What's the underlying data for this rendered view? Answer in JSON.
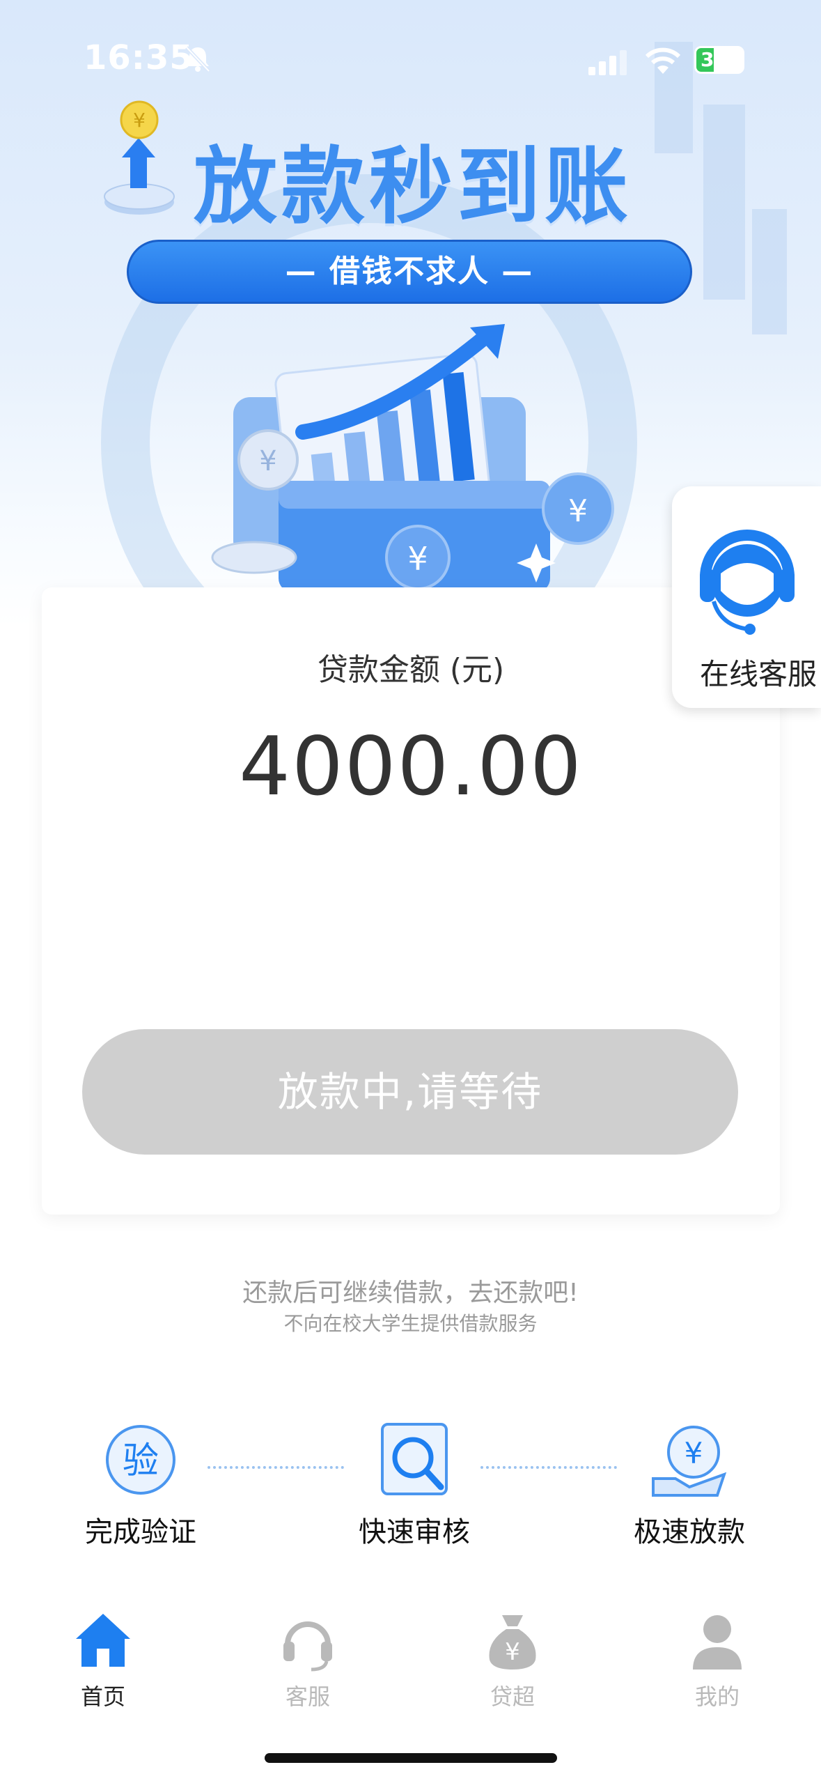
{
  "status_bar": {
    "time": "16:35",
    "battery": "36"
  },
  "banner": {
    "headline": "放款秒到账",
    "slogan": "— 借钱不求人 —"
  },
  "loan_card": {
    "amount_label": "贷款金额 (元)",
    "amount_value": "4000.00",
    "status_button": "放款中,请等待"
  },
  "online_service": {
    "label": "在线客服"
  },
  "notices": {
    "line1": "还款后可继续借款，去还款吧!",
    "line2": "不向在校大学生提供借款服务"
  },
  "steps": [
    {
      "label": "完成验证",
      "icon": "verify-icon",
      "glyph": "验"
    },
    {
      "label": "快速审核",
      "icon": "search-review-icon"
    },
    {
      "label": "极速放款",
      "icon": "yen-disburse-icon",
      "glyph": "¥"
    }
  ],
  "tabs": [
    {
      "label": "首页",
      "icon": "home-icon",
      "active": true
    },
    {
      "label": "客服",
      "icon": "headset-icon",
      "active": false
    },
    {
      "label": "贷超",
      "icon": "money-bag-icon",
      "active": false
    },
    {
      "label": "我的",
      "icon": "profile-icon",
      "active": false
    }
  ],
  "colors": {
    "accent": "#1e7ff0",
    "inactive_tab": "#b9b9b9",
    "button_disabled": "#cfcfcf"
  }
}
